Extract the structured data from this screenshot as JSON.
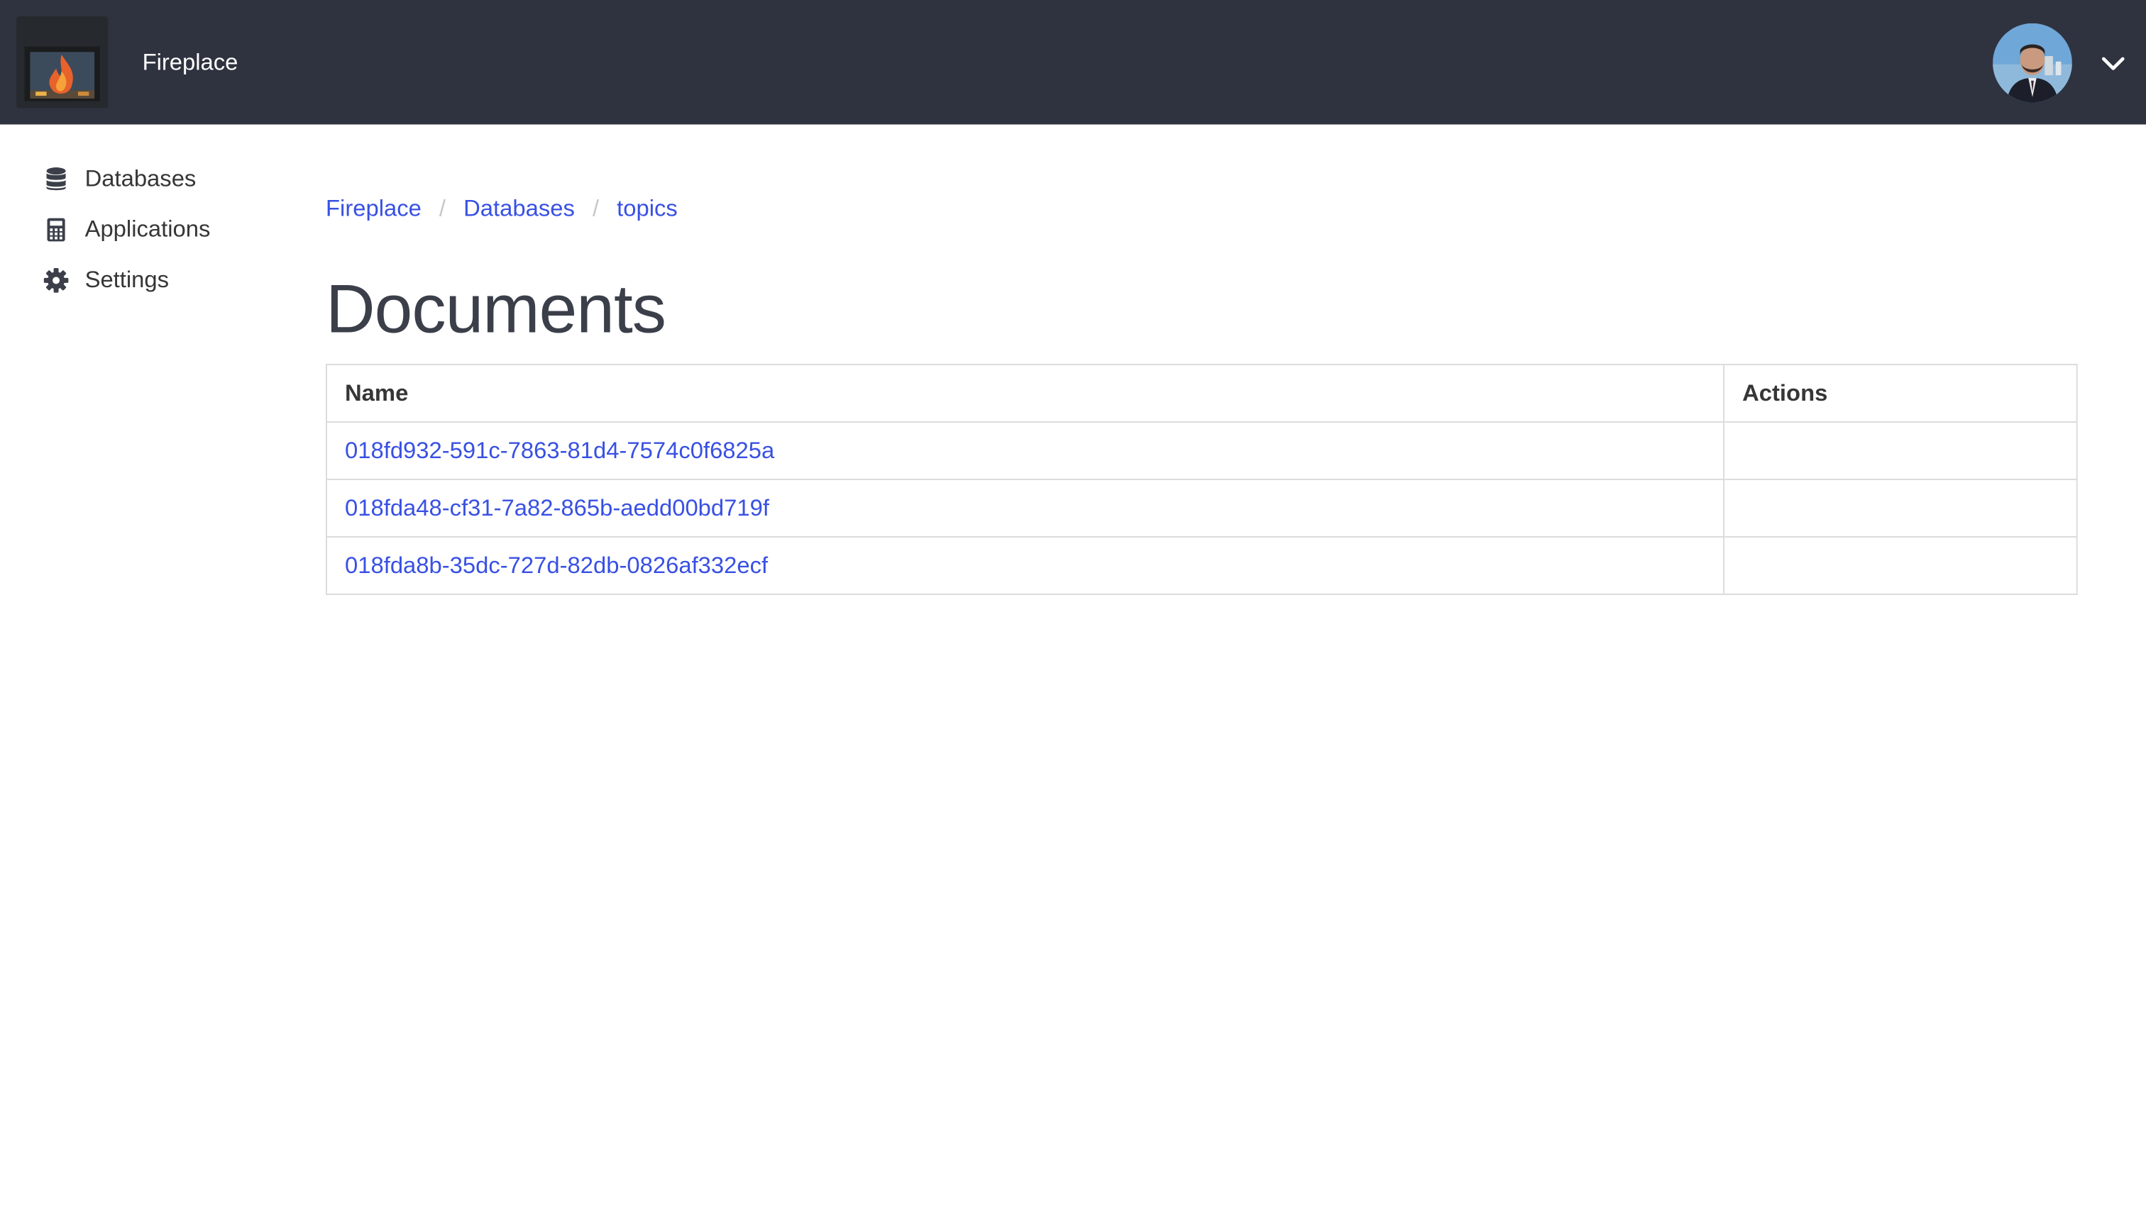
{
  "header": {
    "brand": "Fireplace",
    "logo_icon": "fireplace-icon",
    "avatar_icon": "user-avatar",
    "menu_icon": "chevron-down-icon"
  },
  "sidebar": {
    "items": [
      {
        "label": "Databases",
        "icon": "database-icon"
      },
      {
        "label": "Applications",
        "icon": "calculator-icon"
      },
      {
        "label": "Settings",
        "icon": "gear-icon"
      }
    ]
  },
  "breadcrumb": {
    "items": [
      "Fireplace",
      "Databases",
      "topics"
    ],
    "separator": "/"
  },
  "main": {
    "title": "Documents",
    "table": {
      "columns": [
        "Name",
        "Actions"
      ],
      "rows": [
        {
          "name": "018fd932-591c-7863-81d4-7574c0f6825a",
          "actions": ""
        },
        {
          "name": "018fda48-cf31-7a82-865b-aedd00bd719f",
          "actions": ""
        },
        {
          "name": "018fda8b-35dc-727d-82db-0826af332ecf",
          "actions": ""
        }
      ]
    }
  },
  "colors": {
    "topbar": "#2f333f",
    "link": "#3850e3",
    "title": "#3b3f4a",
    "border": "#dbdbdb"
  }
}
